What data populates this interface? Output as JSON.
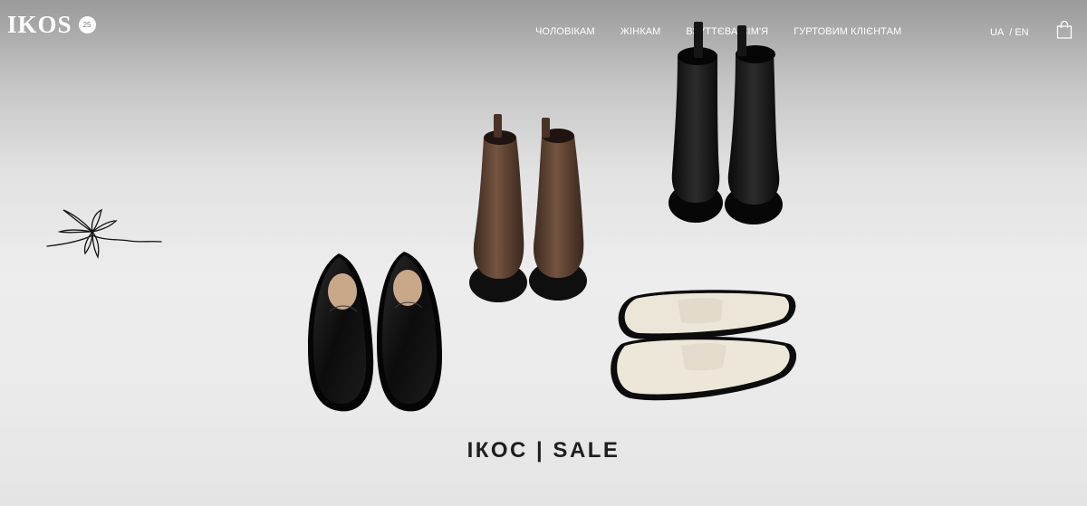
{
  "header": {
    "logo_text": "IKOS",
    "logo_badge": "25",
    "nav": [
      {
        "label": "ЧОЛОВІКАМ"
      },
      {
        "label": "ЖІНКАМ"
      },
      {
        "label": "ВЗУТТЄВА СІМ'Я"
      },
      {
        "label": "ГУРТОВИМ КЛІЄНТАМ"
      }
    ],
    "lang": {
      "ua": "UA",
      "separator": "/",
      "en": "EN"
    },
    "cart_icon": "shopping-bag-icon"
  },
  "hero": {
    "headline": "ІКОС | SALE",
    "decor_icon": "flower-sketch-icon"
  },
  "colors": {
    "header_text": "#ffffff",
    "headline": "#1e1e1e",
    "leather_black": "#111111",
    "leather_brown": "#5d4132",
    "leather_cream": "#ece5d6"
  }
}
